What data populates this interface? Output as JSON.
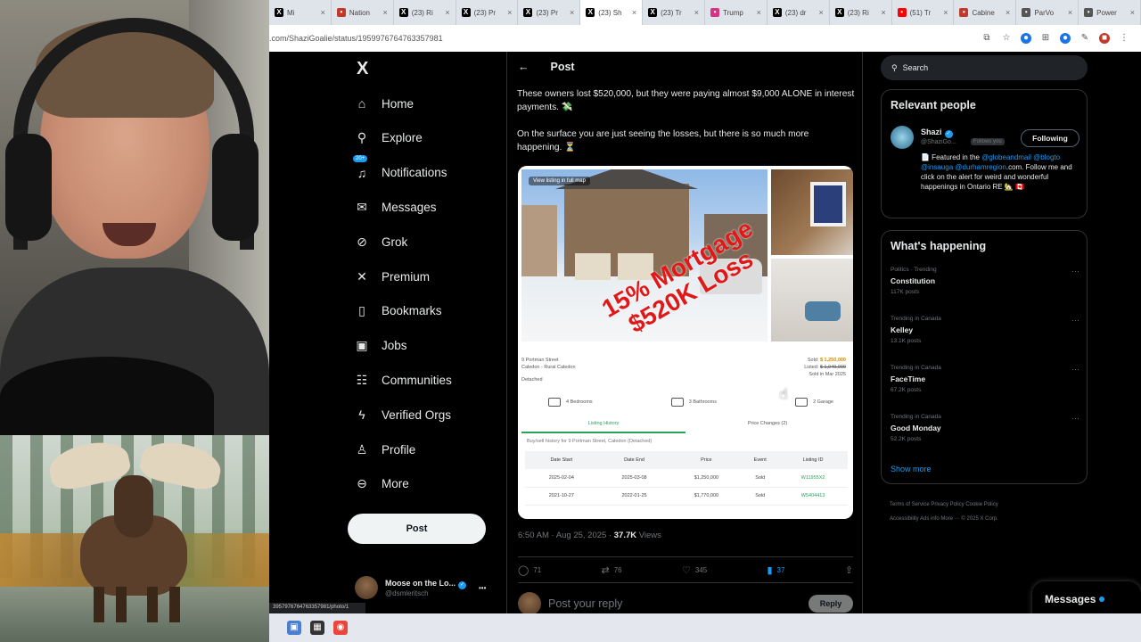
{
  "browser": {
    "tabs": [
      {
        "label": "Mi",
        "icon": "x-icon",
        "color": "#000000"
      },
      {
        "label": "Nation",
        "icon": "news-icon",
        "color": "#c0392b"
      },
      {
        "label": "(23) Ri",
        "icon": "x-icon",
        "color": "#000000"
      },
      {
        "label": "(23) Pr",
        "icon": "x-icon",
        "color": "#000000"
      },
      {
        "label": "(23) Pr",
        "icon": "x-icon",
        "color": "#000000"
      },
      {
        "label": "(23) Sh",
        "icon": "x-icon",
        "color": "#000000",
        "active": true
      },
      {
        "label": "(23) Tr",
        "icon": "x-icon",
        "color": "#000000"
      },
      {
        "label": "Trump",
        "icon": "star-icon",
        "color": "#d63384"
      },
      {
        "label": "(23) dr",
        "icon": "x-icon",
        "color": "#000000"
      },
      {
        "label": "(23) Ri",
        "icon": "x-icon",
        "color": "#000000"
      },
      {
        "label": "(51) Tr",
        "icon": "youtube-icon",
        "color": "#ff0000"
      },
      {
        "label": "Cabine",
        "icon": "news-icon",
        "color": "#c0392b"
      },
      {
        "label": "ParVo",
        "icon": "globe-icon",
        "color": "#555555"
      },
      {
        "label": "Power",
        "icon": "globe-icon",
        "color": "#555555"
      }
    ],
    "url": ".com/ShaziGoalie/status/1959976764763357981",
    "status_url": "3957976764763357981/photo/1"
  },
  "nav": {
    "logo": "X",
    "items": [
      {
        "label": "Home",
        "icon": "home-icon",
        "glyph": "⌂"
      },
      {
        "label": "Explore",
        "icon": "search-icon",
        "glyph": "⚲"
      },
      {
        "label": "Notifications",
        "icon": "bell-icon",
        "glyph": "♫",
        "badge": "20+"
      },
      {
        "label": "Messages",
        "icon": "mail-icon",
        "glyph": "✉"
      },
      {
        "label": "Grok",
        "icon": "grok-icon",
        "glyph": "⊘"
      },
      {
        "label": "Premium",
        "icon": "x-icon",
        "glyph": "✕"
      },
      {
        "label": "Bookmarks",
        "icon": "bookmark-icon",
        "glyph": "▯"
      },
      {
        "label": "Jobs",
        "icon": "briefcase-icon",
        "glyph": "▣"
      },
      {
        "label": "Communities",
        "icon": "people-icon",
        "glyph": "☷"
      },
      {
        "label": "Verified Orgs",
        "icon": "lightning-icon",
        "glyph": "ϟ"
      },
      {
        "label": "Profile",
        "icon": "person-icon",
        "glyph": "♙"
      },
      {
        "label": "More",
        "icon": "more-icon",
        "glyph": "⊖"
      }
    ],
    "post_label": "Post",
    "account": {
      "name": "Moose on the Lo...",
      "handle": "@dsmleritsch",
      "more": "•••"
    }
  },
  "main": {
    "back": "←",
    "title": "Post",
    "text_1": "These owners lost $520,000, but they were paying almost $9,000 ALONE in interest payments. 💸",
    "text_2": "On the surface you are just seeing the losses, but there is so much more happening. ⏳",
    "media": {
      "map_label": "View listing in full map",
      "overlay_line1": "15% Mortgage",
      "overlay_line2": "$520K Loss",
      "address_1": "9 Portman Street",
      "address_2": "Caledon - Rural Caledon",
      "address_3": "Detached",
      "sold_label": "Sold:",
      "sold_price": "$ 1,250,000",
      "listed_label": "Listed:",
      "listed_price": "$ 1,949,000",
      "sold_date": "Sold in Mar 2025",
      "bedrooms": "4 Bedrooms",
      "bathrooms": "3 Bathrooms",
      "garage": "2 Garage",
      "tab_history": "Listing History",
      "tab_price": "Price Changes (2)",
      "buy_history": "Buy/sell history for 9 Portman Street, Caledon (Detached)",
      "table_headers": [
        "Date Start",
        "Date End",
        "Price",
        "Event",
        "Listing ID"
      ],
      "table_rows": [
        [
          "2025-02-04",
          "2025-03-08",
          "$1,250,000",
          "Sold",
          "W11955X2"
        ],
        [
          "2021-10-27",
          "2022-01-25",
          "$1,770,000",
          "Sold",
          "W5404413"
        ]
      ]
    },
    "time": "6:50 AM · Aug 25, 2025 ·",
    "views": "37.7K",
    "views_label": "Views",
    "replies": "71",
    "reposts": "76",
    "likes": "345",
    "bookmarks": "37",
    "reply_placeholder": "Post your reply",
    "reply_button": "Reply"
  },
  "right": {
    "search_placeholder": "Search",
    "relevant_title": "Relevant people",
    "person": {
      "name": "Shazi",
      "handle": "@ShaziGo...",
      "follows_you": "Follows you",
      "follow_button": "Following",
      "bio_1": "📄 Featured in the ",
      "bio_links": "@globeandmail @blogto @insauga @durhamregion",
      "bio_2": ".com. Follow me and click on the alert for weird and wonderful happenings in Ontario RE 🏡 🇨🇦"
    },
    "happening_title": "What's happening",
    "trends": [
      {
        "context": "Politics · Trending",
        "title": "Constitution",
        "count": "117K posts"
      },
      {
        "context": "Trending in Canada",
        "title": "Kelley",
        "count": "13.1K posts"
      },
      {
        "context": "Trending in Canada",
        "title": "FaceTime",
        "count": "67.2K posts"
      },
      {
        "context": "Trending in Canada",
        "title": "Good Monday",
        "count": "52.2K posts"
      }
    ],
    "show_more": "Show more",
    "footer_1": "Terms of Service   Privacy Policy   Cookie Policy",
    "footer_2": "Accessibility   Ads info   More ···   © 2025 X Corp.",
    "messages_dock": "Messages"
  },
  "colors": {
    "accent": "#1d9bf0",
    "bg": "#000000",
    "overlay_red": "#e01818"
  }
}
